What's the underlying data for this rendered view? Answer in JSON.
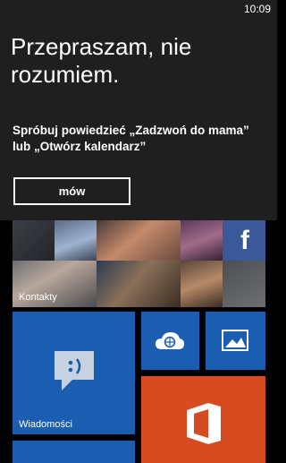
{
  "status_bar": {
    "time": "10:09"
  },
  "speech": {
    "headline": "Przepraszam, nie rozumiem.",
    "hint_line1": "Spróbuj powiedzieć „Zadzwoń do mama”",
    "hint_line2": "lub „Otwórz kalendarz”",
    "button_label": "mów"
  },
  "start_screen": {
    "tiles": {
      "people": {
        "label": "Kontakty"
      },
      "messaging": {
        "label": "Wiadomości",
        "icon": "messaging-icon"
      },
      "onedrive": {
        "icon": "onedrive-icon"
      },
      "photos": {
        "icon": "photos-icon"
      },
      "office": {
        "icon": "office-icon"
      }
    },
    "facebook_icon": "f"
  },
  "colors": {
    "panel": "#1f1f1f",
    "tile_blue": "#1b5eb1",
    "office_orange": "#d64b1f",
    "background": "#000000"
  }
}
